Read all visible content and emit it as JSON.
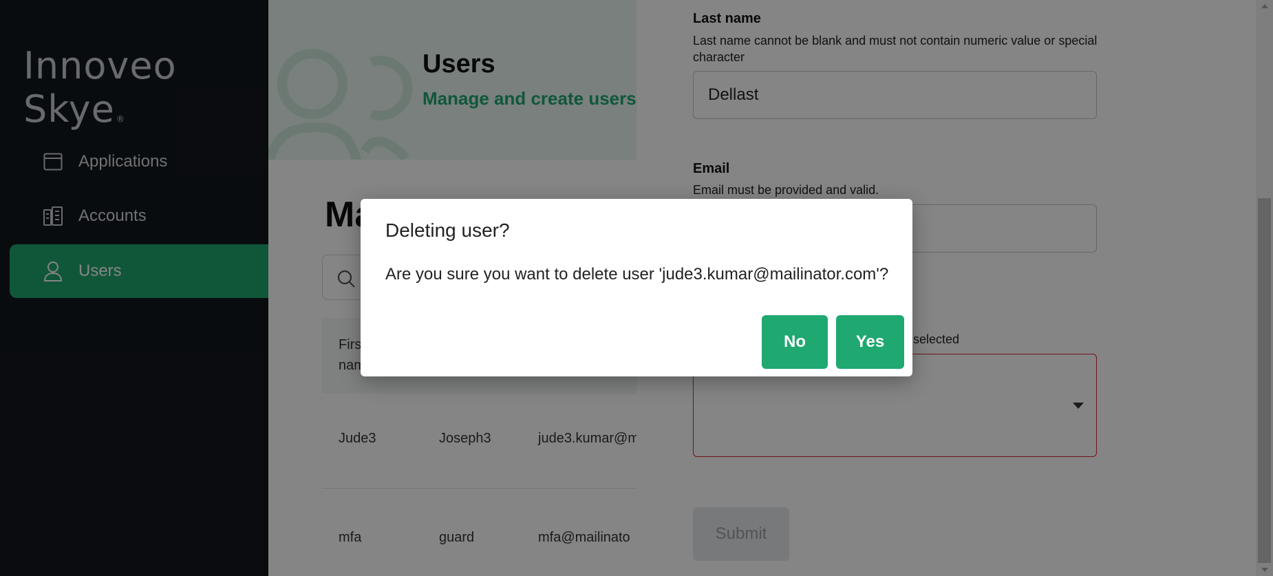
{
  "app": {
    "logo_text": "Innoveo Skye",
    "logo_mark": "®"
  },
  "sidebar": {
    "items": [
      {
        "label": "Applications",
        "icon": "browser-window-icon"
      },
      {
        "label": "Accounts",
        "icon": "building-icon"
      },
      {
        "label": "Users",
        "icon": "user-icon",
        "active": true
      }
    ]
  },
  "header": {
    "title": "Users",
    "subtitle": "Manage and create users"
  },
  "main": {
    "section_title": "Ma",
    "table_header_first": "First name",
    "rows": [
      {
        "first": "Jude3",
        "last": "Joseph3",
        "email": "jude3.kumar@m"
      },
      {
        "first": "mfa",
        "last": "guard",
        "email": "mfa@mailinato"
      }
    ]
  },
  "form": {
    "last_name_label": "Last name",
    "last_name_hint": "Last name cannot be blank and must not contain numeric value or special character",
    "last_name_value": "Dellast",
    "email_label": "Email",
    "email_hint": "Email must be provided and valid.",
    "select_hint_partial": "selected",
    "submit_label": "Submit"
  },
  "dialog": {
    "title": "Deleting user?",
    "message": "Are you sure you want to delete user 'jude3.kumar@mailinator.com'?",
    "no_label": "No",
    "yes_label": "Yes"
  },
  "colors": {
    "accent": "#1fa870",
    "sidebar_bg": "#13171c",
    "error": "#d7262c"
  }
}
